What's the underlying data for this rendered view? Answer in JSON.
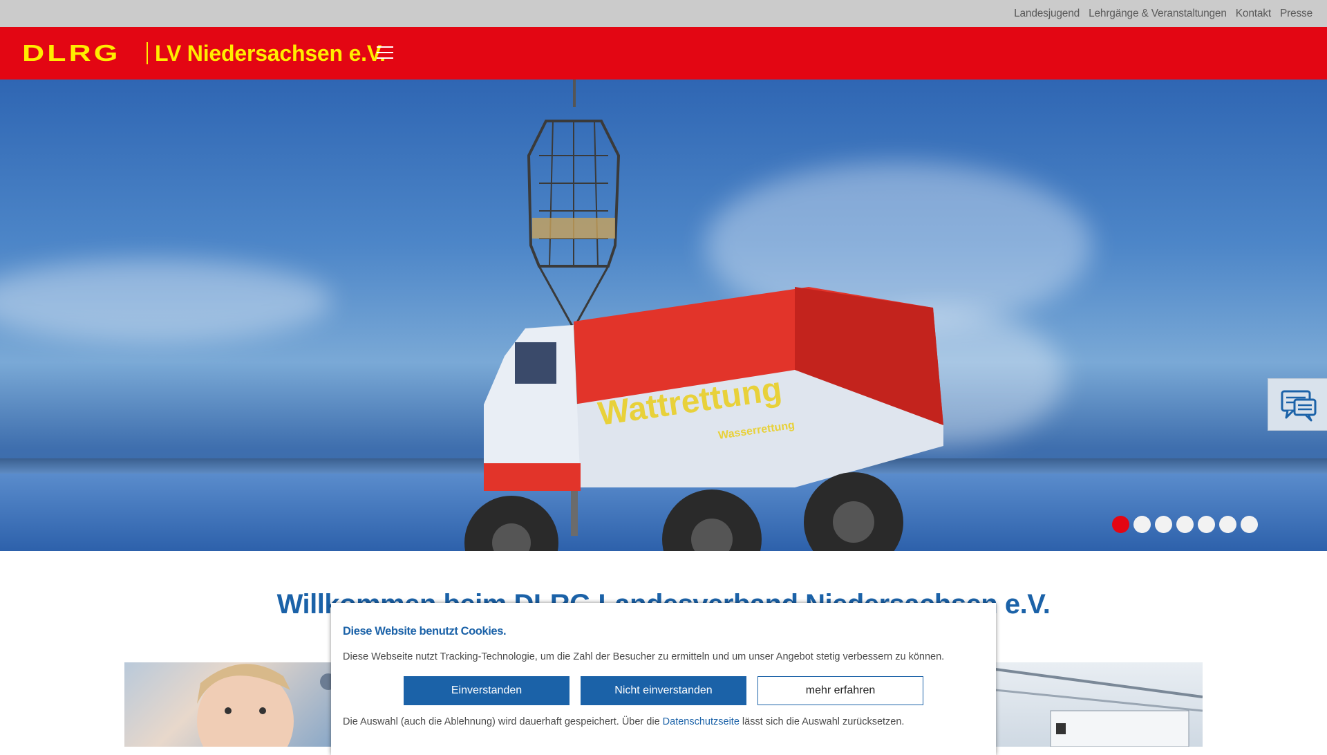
{
  "topnav": {
    "items": [
      "Landesjugend",
      "Lehrgänge & Veranstaltungen",
      "Kontakt",
      "Presse"
    ]
  },
  "header": {
    "logo_text": "DLRG",
    "org_name": "LV Niedersachsen e.V.",
    "menu_icon": "hamburger-menu-icon"
  },
  "hero": {
    "banner_text": "Wattrettung",
    "banner_subtext": "Wasserrettung",
    "slides_count": 7,
    "active_slide": 1
  },
  "chat": {
    "icon": "chat-bubbles-icon"
  },
  "main": {
    "welcome_title": "Willkommen beim DLRG Landesverband Niedersachsen e.V."
  },
  "cookie": {
    "title": "Diese Website benutzt Cookies.",
    "description": "Diese Webseite nutzt Tracking-Technologie, um die Zahl der Besucher zu ermitteln und um unser Angebot stetig verbessern zu können.",
    "accept_label": "Einverstanden",
    "decline_label": "Nicht einverstanden",
    "more_label": "mehr erfahren",
    "note_prefix": "Die Auswahl (auch die Ablehnung) wird dauerhaft gespeichert. Über die ",
    "note_link": "Datenschutzseite",
    "note_suffix": " lässt sich die Auswahl zurücksetzen."
  },
  "colors": {
    "brand_red": "#e30613",
    "brand_yellow": "#ffed00",
    "brand_blue": "#1b62a8",
    "topbar_gray": "#cbcbcb"
  }
}
